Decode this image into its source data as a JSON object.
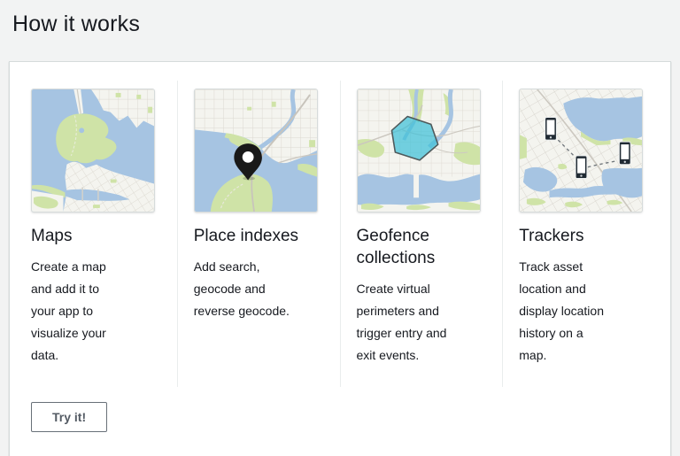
{
  "page": {
    "heading": "How it works"
  },
  "panel": {
    "cards": [
      {
        "title": "Maps",
        "description": "Create a map\nand add it to\nyour app to\nvisualize your\ndata.",
        "thumbnail_icon": "map-overview-thumbnail"
      },
      {
        "title": "Place indexes",
        "description": "Add search,\ngeocode and\nreverse geocode.",
        "thumbnail_icon": "map-location-pin-thumbnail"
      },
      {
        "title": "Geofence collections",
        "description": "Create virtual\nperimeters and\ntrigger entry and\nexit events.",
        "thumbnail_icon": "map-geofence-hexagon-thumbnail"
      },
      {
        "title": "Trackers",
        "description": "Track asset\nlocation and\ndisplay location\nhistory on a\nmap.",
        "thumbnail_icon": "map-tracked-devices-thumbnail"
      }
    ],
    "try_button_label": "Try it!"
  },
  "colors": {
    "page_background": "#f2f3f3",
    "panel_background": "#ffffff",
    "panel_border": "#d5dbdb",
    "divider": "#eaeded",
    "heading_text": "#16191f",
    "body_text": "#16191f",
    "button_text": "#545b64",
    "button_border": "#687078",
    "map_water": "#a6c4e2",
    "map_green": "#cfe3a7",
    "map_land": "#f4f4ef",
    "geofence_fill": "#3fc1d8",
    "pin_color": "#191919",
    "device_color": "#202a33"
  }
}
